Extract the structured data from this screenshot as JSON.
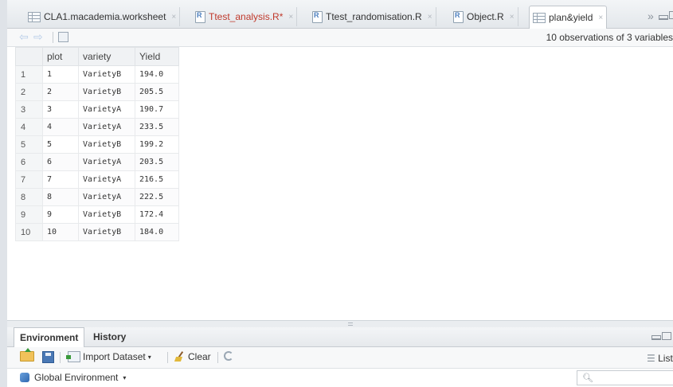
{
  "tabs": [
    {
      "label": "CLA1.macademia.worksheet",
      "icon": "spreadsheet-icon",
      "modified": false
    },
    {
      "label": "Ttest_analysis.R",
      "icon": "r-file-icon",
      "modified": true,
      "modified_mark": "*"
    },
    {
      "label": "Ttest_randomisation.R",
      "icon": "r-file-icon",
      "modified": false
    },
    {
      "label": "Object.R",
      "icon": "r-file-icon",
      "modified": false
    },
    {
      "label": "plan&yield",
      "icon": "spreadsheet-icon",
      "modified": false,
      "active": true
    }
  ],
  "tab_close_glyph": "×",
  "more_tabs_glyph": "»",
  "viewer": {
    "summary": "10 observations of 3 variables"
  },
  "table": {
    "columns": [
      "",
      "plot",
      "variety",
      "Yield"
    ],
    "rows": [
      {
        "row": "1",
        "plot": "1",
        "variety": "VarietyB",
        "yield": "194.0"
      },
      {
        "row": "2",
        "plot": "2",
        "variety": "VarietyB",
        "yield": "205.5"
      },
      {
        "row": "3",
        "plot": "3",
        "variety": "VarietyA",
        "yield": "190.7"
      },
      {
        "row": "4",
        "plot": "4",
        "variety": "VarietyA",
        "yield": "233.5"
      },
      {
        "row": "5",
        "plot": "5",
        "variety": "VarietyB",
        "yield": "199.2"
      },
      {
        "row": "6",
        "plot": "6",
        "variety": "VarietyA",
        "yield": "203.5"
      },
      {
        "row": "7",
        "plot": "7",
        "variety": "VarietyA",
        "yield": "216.5"
      },
      {
        "row": "8",
        "plot": "8",
        "variety": "VarietyA",
        "yield": "222.5"
      },
      {
        "row": "9",
        "plot": "9",
        "variety": "VarietyB",
        "yield": "172.4"
      },
      {
        "row": "10",
        "plot": "10",
        "variety": "VarietyB",
        "yield": "184.0"
      }
    ]
  },
  "env_pane": {
    "tabs": [
      "Environment",
      "History"
    ],
    "import_label": "Import Dataset",
    "clear_label": "Clear",
    "list_label": "List",
    "global_env_label": "Global Environment",
    "search_placeholder": ""
  },
  "colors": {
    "modified_tab_text": "#c0392b",
    "header_bg": "#f0f2f4",
    "chrome_bg": "#e3e7eb"
  }
}
